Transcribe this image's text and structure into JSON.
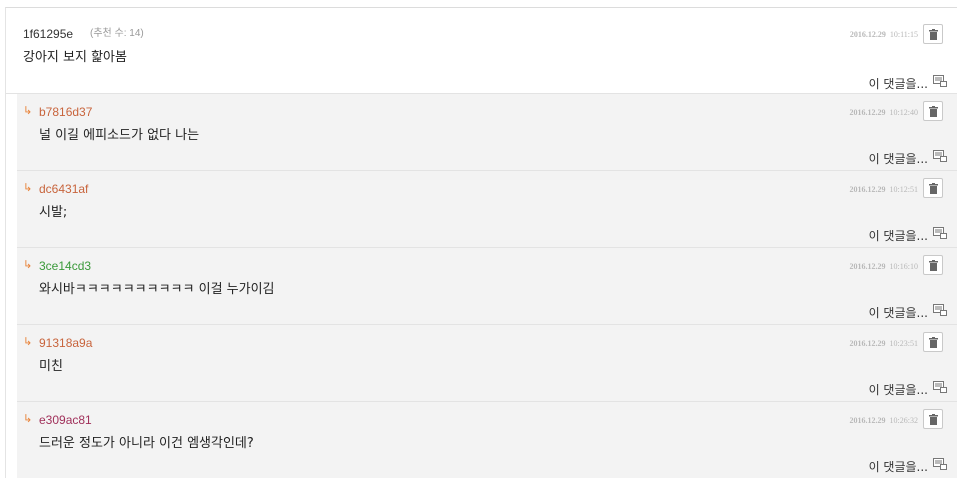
{
  "comments": [
    {
      "author": "1f61295e",
      "author_color": "#333333",
      "votes": "(추천 수: 14)",
      "text": "강아지 보지 핥아봄",
      "date": "2016.12.29",
      "time": "10:11:15",
      "report": "이 댓글을..."
    },
    {
      "author": "b7816d37",
      "author_color": "#c8643c",
      "text": "널 이길 에피소드가 없다 나는",
      "date": "2016.12.29",
      "time": "10:12:40",
      "report": "이 댓글을..."
    },
    {
      "author": "dc6431af",
      "author_color": "#c8643c",
      "text": "시발;",
      "date": "2016.12.29",
      "time": "10:12:51",
      "report": "이 댓글을..."
    },
    {
      "author": "3ce14cd3",
      "author_color": "#3a9a3a",
      "text": "와시바ㅋㅋㅋㅋㅋㅋㅋㅋㅋㅋ 이걸 누가이김",
      "date": "2016.12.29",
      "time": "10:16:10",
      "report": "이 댓글을..."
    },
    {
      "author": "91318a9a",
      "author_color": "#c8643c",
      "text": "미친",
      "date": "2016.12.29",
      "time": "10:23:51",
      "report": "이 댓글을..."
    },
    {
      "author": "e309ac81",
      "author_color": "#a0305a",
      "text": "드러운 정도가 아니라 이건 엠생각인데?",
      "date": "2016.12.29",
      "time": "10:26:32",
      "report": "이 댓글을..."
    }
  ],
  "icons": {
    "delete": "trash-icon",
    "report": "report-icon",
    "reply_arrow": "reply-arrow-icon"
  },
  "colors": {
    "reply_background": "#f3f3f3",
    "reply_arrow": "#e8833a"
  }
}
